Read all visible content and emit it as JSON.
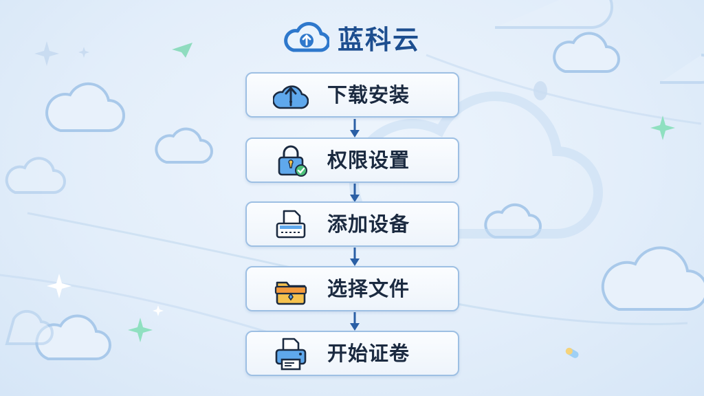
{
  "app": {
    "title": "蓝科云",
    "logo_icon": "cloud-upload-icon"
  },
  "colors": {
    "accent": "#2e6fbf",
    "title": "#1d4e8f",
    "box_border": "#9dbfe3",
    "arrow": "#2a5fa5"
  },
  "steps": [
    {
      "label": "下载安装",
      "icon": "cloud-upload-icon"
    },
    {
      "label": "权限设置",
      "icon": "lock-check-icon"
    },
    {
      "label": "添加设备",
      "icon": "scanner-icon"
    },
    {
      "label": "选择文件",
      "icon": "folder-icon"
    },
    {
      "label": "开始证卷",
      "icon": "printer-icon"
    }
  ]
}
